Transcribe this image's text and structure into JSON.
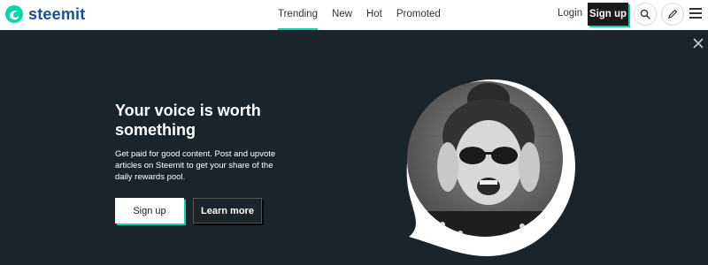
{
  "brand": {
    "name": "steemit",
    "accent": "#06d6a9",
    "logo_color": "#1a5099"
  },
  "nav": {
    "items": [
      {
        "label": "Trending",
        "active": true
      },
      {
        "label": "New",
        "active": false
      },
      {
        "label": "Hot",
        "active": false
      },
      {
        "label": "Promoted",
        "active": false
      }
    ]
  },
  "header": {
    "login_label": "Login",
    "signup_label": "Sign up",
    "icons": [
      "search-icon",
      "pencil-icon",
      "hamburger-menu-icon"
    ]
  },
  "hero": {
    "background": "#1c242b",
    "headline": "Your voice is worth something",
    "subtext": "Get paid for good content. Post and upvote articles on Steemit to get your share of the daily rewards pool.",
    "signup_label": "Sign up",
    "learn_more_label": "Learn more",
    "close_icon": "close-icon",
    "image": "portrait-photo"
  }
}
